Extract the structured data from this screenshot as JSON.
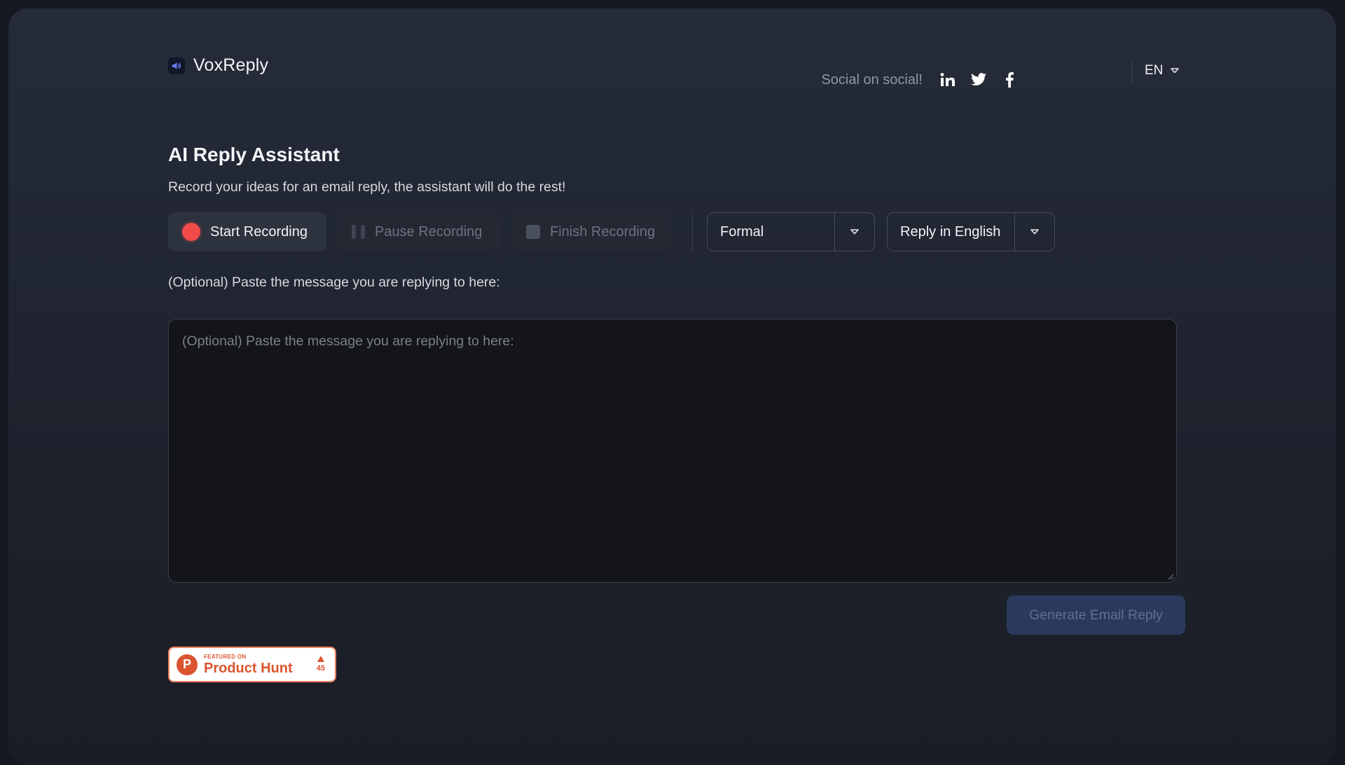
{
  "header": {
    "brand": "VoxReply",
    "brand_icon": "speaker-icon",
    "social_text": "Social on social!",
    "social_icons": [
      "linkedin-icon",
      "twitter-icon",
      "facebook-icon"
    ],
    "language": "EN"
  },
  "main": {
    "title": "AI Reply Assistant",
    "subtitle": "Record your ideas for an email reply, the assistant will do the rest!",
    "controls": {
      "start_label": "Start Recording",
      "pause_label": "Pause Recording",
      "finish_label": "Finish Recording",
      "tone_value": "Formal",
      "reply_language_value": "Reply in English"
    },
    "message": {
      "label": "(Optional) Paste the message you are replying to here:",
      "placeholder": "(Optional) Paste the message you are replying to here:",
      "value": ""
    },
    "generate_label": "Generate Email Reply"
  },
  "badge": {
    "small_text": "FEATURED ON",
    "big_text": "Product Hunt",
    "logo_letter": "P",
    "votes": "45"
  },
  "colors": {
    "record_red": "#f04a4a",
    "generate_bg": "#2a3a5e",
    "product_hunt": "#da552f"
  }
}
